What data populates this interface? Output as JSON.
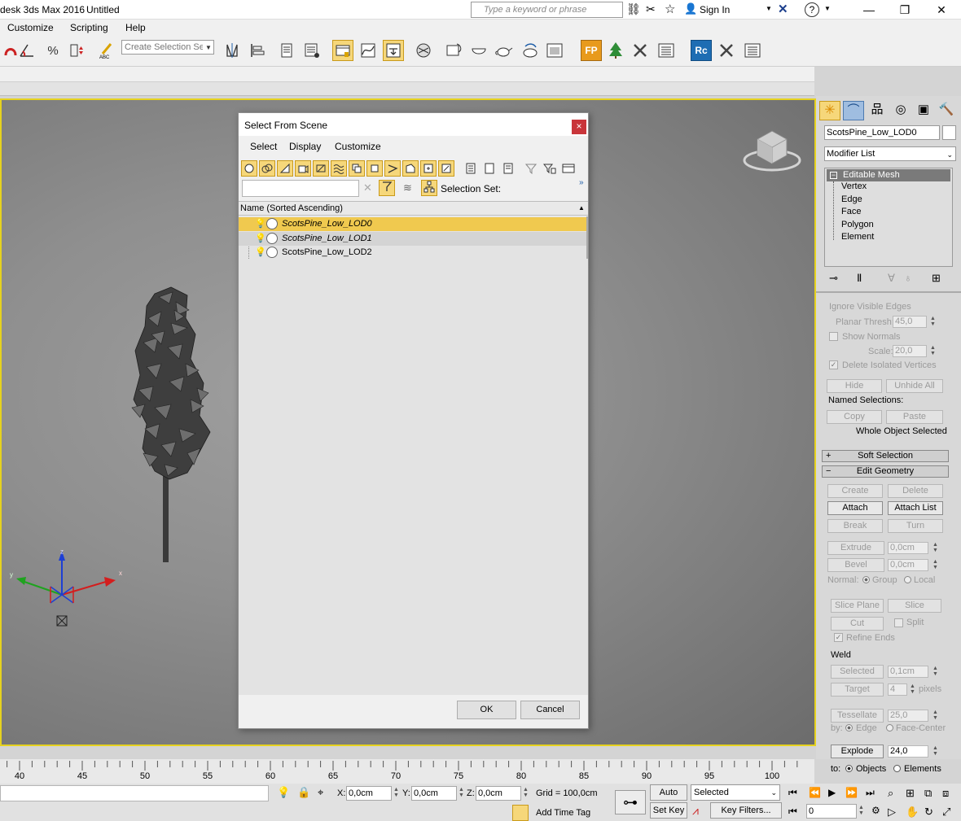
{
  "app": {
    "title_fragment": "desk 3ds Max 2016",
    "document": "Untitled"
  },
  "search": {
    "placeholder": "Type a keyword or phrase"
  },
  "signin": {
    "label": "Sign In"
  },
  "menubar": {
    "items": [
      "Customize",
      "Scripting",
      "Help"
    ]
  },
  "toolbar": {
    "selection_set_placeholder": "Create Selection Se"
  },
  "dialog": {
    "title": "Select From Scene",
    "close": "×",
    "menu": [
      "Select",
      "Display",
      "Customize"
    ],
    "selection_set_label": "Selection Set:",
    "column_header": "Name (Sorted Ascending)",
    "rows": [
      {
        "name": "ScotsPine_Low_LOD0",
        "state": "selected"
      },
      {
        "name": "ScotsPine_Low_LOD1",
        "state": "hidden"
      },
      {
        "name": "ScotsPine_Low_LOD2",
        "state": "normal"
      }
    ],
    "ok": "OK",
    "cancel": "Cancel"
  },
  "panel": {
    "object_name": "ScotsPine_Low_LOD0",
    "modifier_list": "Modifier List",
    "stack": {
      "root": "Editable Mesh",
      "items": [
        "Vertex",
        "Edge",
        "Face",
        "Polygon",
        "Element"
      ]
    },
    "ignore_visible_edges": "Ignore Visible Edges",
    "planar_thresh_label": "Planar Thresh:",
    "planar_thresh_value": "45,0",
    "show_normals": "Show Normals",
    "scale_label": "Scale:",
    "scale_value": "20,0",
    "delete_isolated": "Delete Isolated Vertices",
    "hide": "Hide",
    "unhide_all": "Unhide All",
    "named_selections": "Named Selections:",
    "copy": "Copy",
    "paste": "Paste",
    "whole_object": "Whole Object Selected",
    "soft_selection": "Soft Selection",
    "edit_geometry": "Edit Geometry",
    "create": "Create",
    "delete": "Delete",
    "attach": "Attach",
    "attach_list": "Attach List",
    "break": "Break",
    "turn": "Turn",
    "extrude": "Extrude",
    "extrude_value": "0,0cm",
    "bevel": "Bevel",
    "bevel_value": "0,0cm",
    "normal_label": "Normal:",
    "group": "Group",
    "local": "Local",
    "slice_plane": "Slice Plane",
    "slice": "Slice",
    "cut": "Cut",
    "split": "Split",
    "refine_ends": "Refine Ends",
    "weld": "Weld",
    "weld_selected": "Selected",
    "weld_selected_value": "0,1cm",
    "weld_target": "Target",
    "weld_target_value": "4",
    "pixels": "pixels",
    "tessellate": "Tessellate",
    "tessellate_value": "25,0",
    "by_label": "by:",
    "edge": "Edge",
    "face_center": "Face-Center",
    "explode": "Explode",
    "explode_value": "24,0",
    "to_label": "to:",
    "objects": "Objects",
    "elements": "Elements"
  },
  "timeline": {
    "ticks": [
      "40",
      "45",
      "50",
      "55",
      "60",
      "65",
      "70",
      "75",
      "80",
      "85",
      "90",
      "95",
      "100"
    ]
  },
  "status": {
    "x_label": "X:",
    "x_value": "0,0cm",
    "y_label": "Y:",
    "y_value": "0,0cm",
    "z_label": "Z:",
    "z_value": "0,0cm",
    "grid": "Grid = 100,0cm",
    "add_time_tag": "Add Time Tag",
    "auto_key": "Auto Key",
    "selected": "Selected",
    "set_key": "Set Key",
    "key_filters": "Key Filters...",
    "frame": "0"
  },
  "axis_labels": {
    "x": "x",
    "y": "y",
    "z": "z"
  },
  "colors": {
    "accent": "#f0c94f",
    "viewport_border": "#e6d21e",
    "close_red": "#c9353a"
  }
}
